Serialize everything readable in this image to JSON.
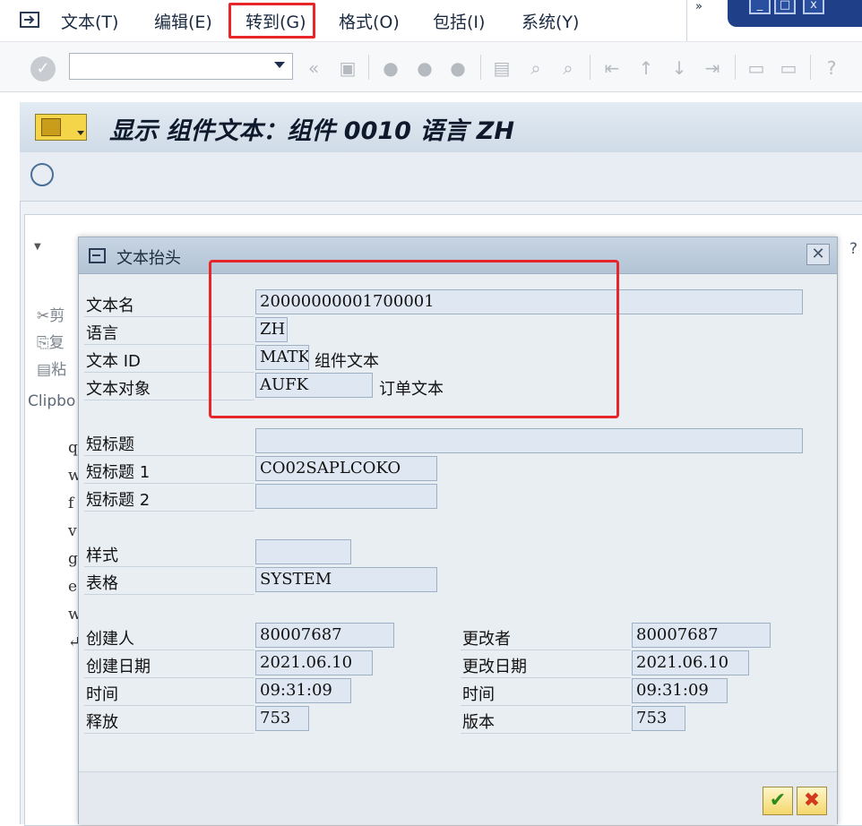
{
  "menu": {
    "items": [
      "文本(T)",
      "编辑(E)",
      "转到(G)",
      "格式(O)",
      "包括(I)",
      "系统(Y)"
    ],
    "overflow": "»"
  },
  "header": {
    "title": "显示 组件文本：组件 0010 语言 ZH"
  },
  "background": {
    "tools": [
      "剪",
      "复",
      "粘"
    ],
    "clipboard": "Clipbo",
    "editor_lines": [
      "q",
      "w",
      "f",
      "v",
      "g",
      "e",
      "w",
      "↵"
    ],
    "help": "?"
  },
  "dialog": {
    "title": "文本抬头",
    "close": "✕",
    "fields": {
      "text_name_label": "文本名",
      "text_name": "20000000001700001",
      "language_label": "语言",
      "language": "ZH",
      "text_id_label": "文本 ID",
      "text_id": "MATK",
      "text_id_desc": "组件文本",
      "text_object_label": "文本对象",
      "text_object": "AUFK",
      "text_object_desc": "订单文本",
      "short_title_label": "短标题",
      "short_title": "",
      "short_title1_label": "短标题 1",
      "short_title1": "CO02SAPLCOKO",
      "short_title2_label": "短标题 2",
      "short_title2": "",
      "style_label": "样式",
      "style": "",
      "form_label": "表格",
      "form": "SYSTEM",
      "created_by_label": "创建人",
      "created_by": "80007687",
      "created_on_label": "创建日期",
      "created_on": "2021.06.10",
      "created_time_label": "时间",
      "created_time": "09:31:09",
      "release_label": "释放",
      "release": "753",
      "changed_by_label": "更改者",
      "changed_by": "80007687",
      "changed_on_label": "更改日期",
      "changed_on": "2021.06.10",
      "changed_time_label": "时间",
      "changed_time": "09:31:09",
      "version_label": "版本",
      "version": "753"
    },
    "ok": "✔",
    "cancel": "✖"
  },
  "colors": {
    "highlight": "#e8262a",
    "window_blue": "#1f3f88",
    "field_bg": "#dfe8f2"
  }
}
